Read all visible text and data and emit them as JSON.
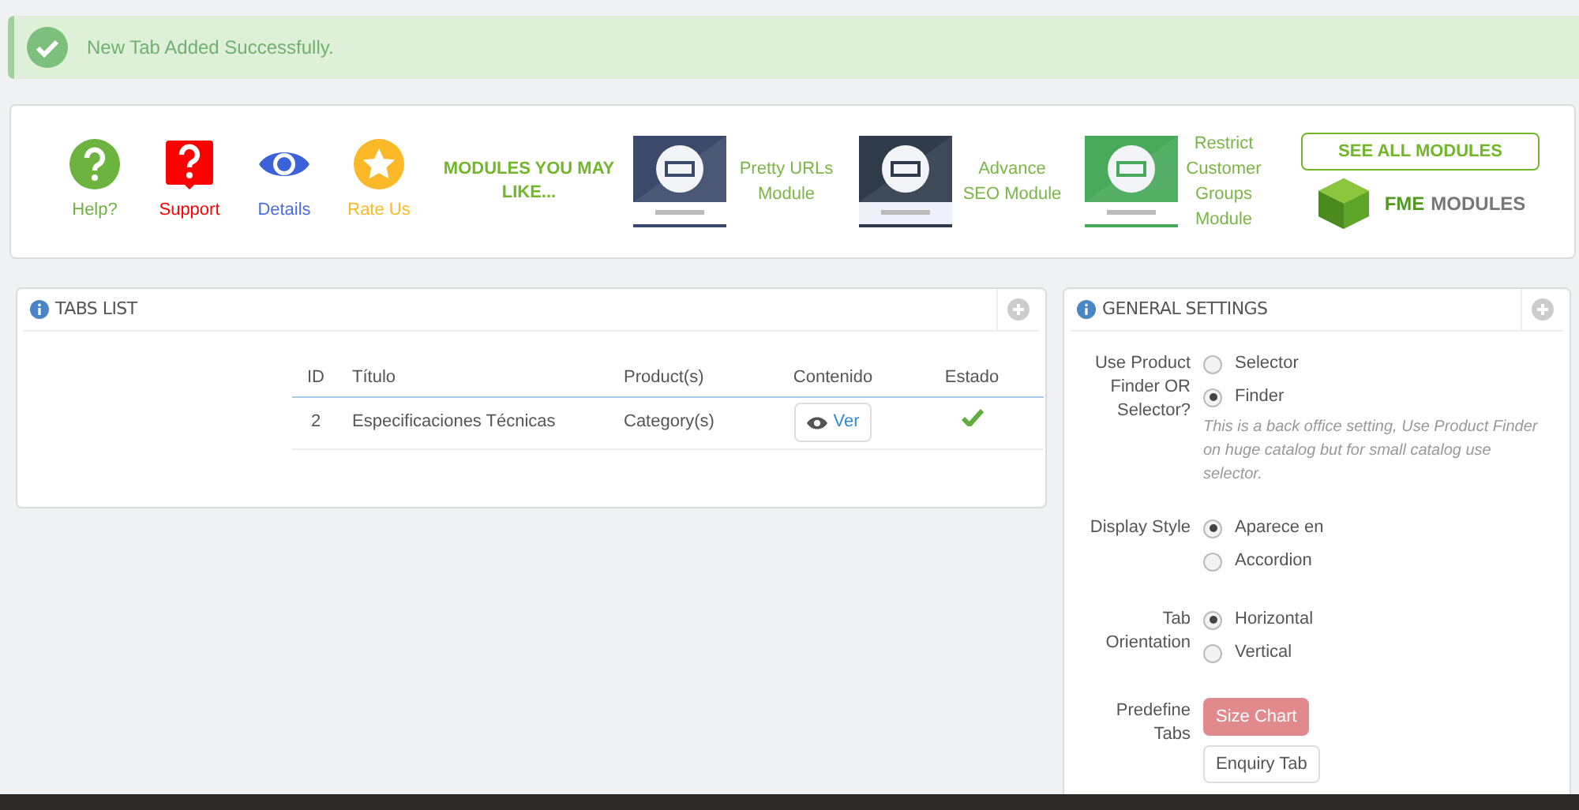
{
  "alert": {
    "message": "New Tab Added Successfully."
  },
  "modules_bar": {
    "links": [
      {
        "kind": "help",
        "label": "Help?"
      },
      {
        "kind": "support",
        "label": "Support"
      },
      {
        "kind": "details",
        "label": "Details"
      },
      {
        "kind": "rate",
        "label": "Rate Us"
      }
    ],
    "heading": "MODULES YOU MAY LIKE...",
    "suggestions": [
      {
        "kind": "picture",
        "title": "Pretty URLs Module"
      },
      {
        "kind": "picture",
        "title": "Advance SEO Module"
      },
      {
        "kind": "picture",
        "title": "Restrict Customer Groups Module"
      }
    ],
    "see_all_button": "SEE ALL MODULES",
    "brand": {
      "bold": "FME",
      "rest": "MODULES"
    }
  },
  "tabs_list": {
    "title": "TABS LIST",
    "columns": [
      "ID",
      "Título",
      "Product(s)",
      "Contenido",
      "Estado"
    ],
    "rows": [
      {
        "id": "2",
        "title": "Especificaciones Técnicas",
        "products": "Category(s)",
        "view_button": "Ver",
        "enabled": true
      }
    ]
  },
  "general_settings": {
    "title": "GENERAL SETTINGS",
    "fields": [
      {
        "kind": "radio",
        "label": "Use Product Finder OR Selector?",
        "options": [
          {
            "label": "Selector",
            "selected": false
          },
          {
            "label": "Finder",
            "selected": true
          }
        ],
        "help": "This is a back office setting, Use Product Finder on huge catalog but for small catalog use selector."
      },
      {
        "kind": "radio",
        "label": "Display Style",
        "options": [
          {
            "label": "Aparece en",
            "selected": true
          },
          {
            "label": "Accordion",
            "selected": false
          }
        ]
      },
      {
        "kind": "radio",
        "label": "Tab Orientation",
        "options": [
          {
            "label": "Horizontal",
            "selected": true
          },
          {
            "label": "Vertical",
            "selected": false
          }
        ]
      },
      {
        "kind": "buttons",
        "label": "Predefine Tabs",
        "options": [
          {
            "label": "Size Chart",
            "selected": true
          },
          {
            "label": "Enquiry Tab",
            "selected": false
          }
        ]
      }
    ]
  }
}
